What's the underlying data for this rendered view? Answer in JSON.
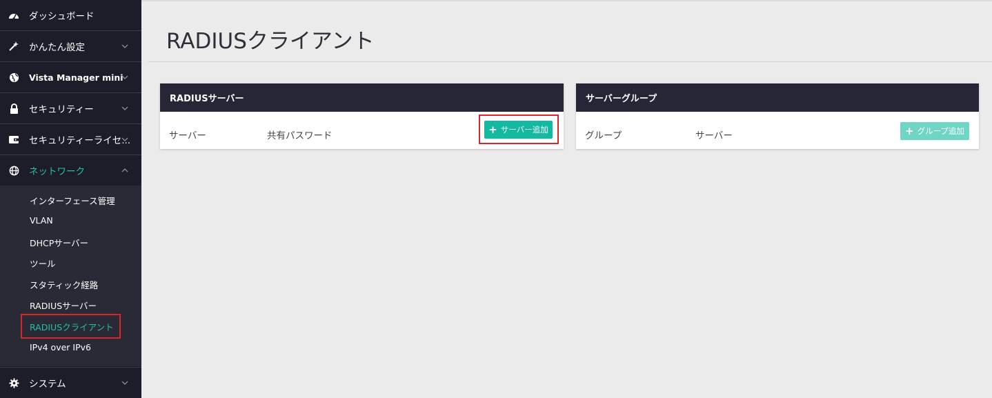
{
  "sidebar": {
    "items": [
      {
        "label": "ダッシュボード",
        "icon": "dashboard-gauge-icon"
      },
      {
        "label": "かんたん設定",
        "icon": "magic-wand-icon"
      },
      {
        "label": "Vista Manager mini",
        "icon": "globe-icon"
      },
      {
        "label": "セキュリティー",
        "icon": "lock-icon"
      },
      {
        "label": "セキュリティーライセ...",
        "icon": "wallet-icon"
      },
      {
        "label": "ネットワーク",
        "icon": "network-globe-icon"
      },
      {
        "label": "システム",
        "icon": "gear-icon"
      }
    ],
    "network_submenu": [
      "インターフェース管理",
      "VLAN",
      "DHCPサーバー",
      "ツール",
      "スタティック経路",
      "RADIUSサーバー",
      "RADIUSクライアント",
      "IPv4 over IPv6"
    ],
    "active_sub_index": 6
  },
  "main": {
    "title": "RADIUSクライアント",
    "panels": {
      "server": {
        "header": "RADIUSサーバー",
        "columns": [
          "サーバー",
          "共有パスワード"
        ],
        "add_button": "サーバー追加"
      },
      "group": {
        "header": "サーバーグループ",
        "columns": [
          "グループ",
          "サーバー"
        ],
        "add_button": "グループ追加"
      }
    }
  },
  "colors": {
    "accent": "#22c1a8",
    "button": "#13b9a0",
    "sidebar_bg": "#1d1d29",
    "highlight": "#d8262c"
  }
}
